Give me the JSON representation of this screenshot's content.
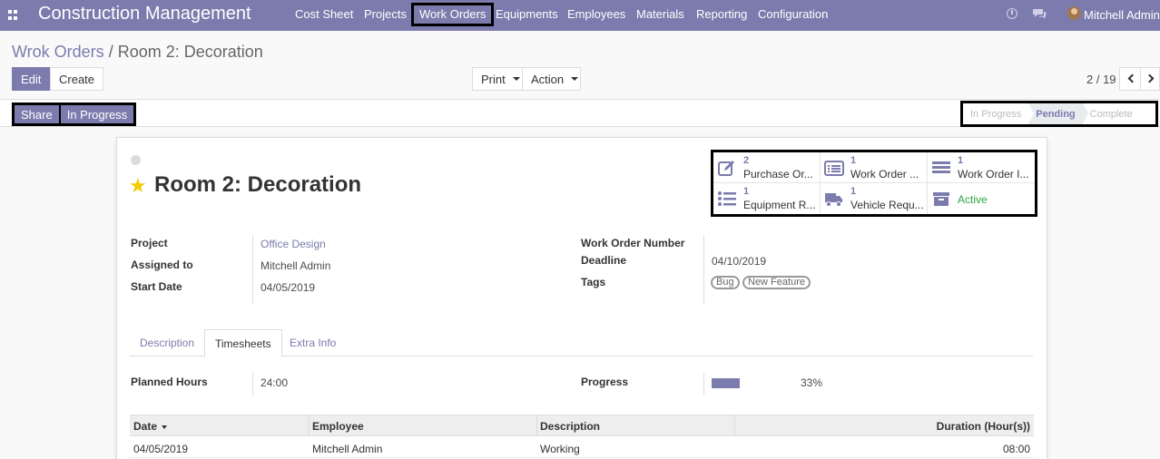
{
  "navbar": {
    "brand": "Construction Management",
    "menu": [
      "Cost Sheet",
      "Projects",
      "Work Orders",
      "Equipments",
      "Employees",
      "Materials",
      "Reporting",
      "Configuration"
    ],
    "active_menu": "Work Orders",
    "user": "Mitchell Admin",
    "accent_color": "#7c7bad"
  },
  "breadcrumb": {
    "parent": "Wrok Orders",
    "separator": "/",
    "current": "Room 2: Decoration"
  },
  "toolbar": {
    "edit": "Edit",
    "create": "Create",
    "print": "Print",
    "action": "Action"
  },
  "pager": {
    "value": "2 / 19"
  },
  "header_buttons": {
    "share": "Share",
    "in_progress": "In Progress"
  },
  "stages": {
    "items": [
      "In Progress",
      "Pending",
      "Complete"
    ],
    "current": "Pending"
  },
  "record": {
    "title": "Room 2: Decoration",
    "starred": true
  },
  "smart_buttons": [
    {
      "count": "2",
      "label": "Purchase Or...",
      "icon": "pencil-square-icon"
    },
    {
      "count": "1",
      "label": "Work Order ...",
      "icon": "list-alt-icon"
    },
    {
      "count": "1",
      "label": "Work Order I...",
      "icon": "bars-icon"
    },
    {
      "count": "1",
      "label": "Equipment R...",
      "icon": "list-ul-icon"
    },
    {
      "count": "1",
      "label": "Vehicle Requ...",
      "icon": "truck-icon"
    },
    {
      "count": "",
      "label": "Active",
      "icon": "archive-icon"
    }
  ],
  "fields": {
    "project_label": "Project",
    "project_value": "Office Design",
    "assigned_label": "Assigned to",
    "assigned_value": "Mitchell Admin",
    "start_label": "Start Date",
    "start_value": "04/05/2019",
    "wo_number_label": "Work Order Number",
    "deadline_label": "Deadline",
    "deadline_value": "04/10/2019",
    "tags_label": "Tags",
    "tags": [
      "Bug",
      "New Feature"
    ]
  },
  "tabs": {
    "items": [
      "Description",
      "Timesheets",
      "Extra Info"
    ],
    "active": "Timesheets"
  },
  "timesheets": {
    "planned_label": "Planned Hours",
    "planned_value": "24:00",
    "progress_label": "Progress",
    "progress_value": "33%",
    "progress_fraction": 0.33,
    "columns": [
      "Date",
      "Employee",
      "Description",
      "Duration (Hour(s))"
    ],
    "rows": [
      {
        "date": "04/05/2019",
        "employee": "Mitchell Admin",
        "description": "Working",
        "duration": "08:00"
      }
    ]
  }
}
